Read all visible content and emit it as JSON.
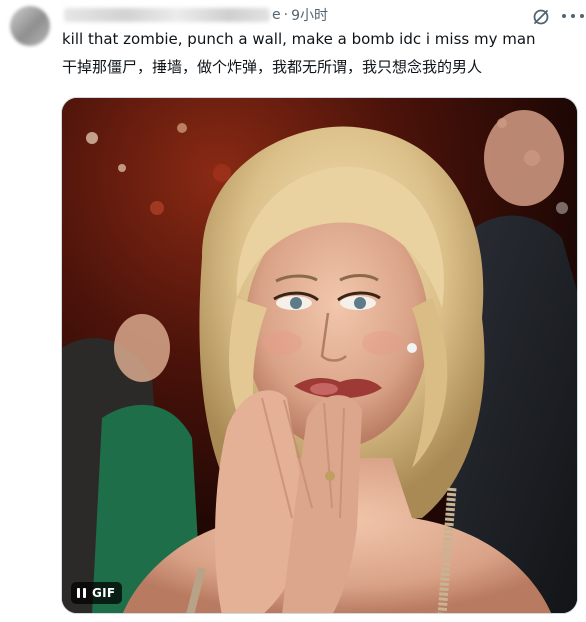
{
  "post": {
    "handle_fragment": "e",
    "separator": "·",
    "timestamp": "9小时",
    "text": "kill that zombie, punch a wall, make a bomb idc i miss my man",
    "translation": "干掉那僵尸，捶墙，做个炸弹，我都无所谓，我只想念我的男人"
  },
  "media": {
    "badge_label": "GIF",
    "badge_icon": "pause-icon"
  },
  "icons": {
    "grok": "grok-icon",
    "more": "more-icon"
  },
  "colors": {
    "text_primary": "#0f1419",
    "text_secondary": "#536471",
    "border": "#cfd9de"
  }
}
